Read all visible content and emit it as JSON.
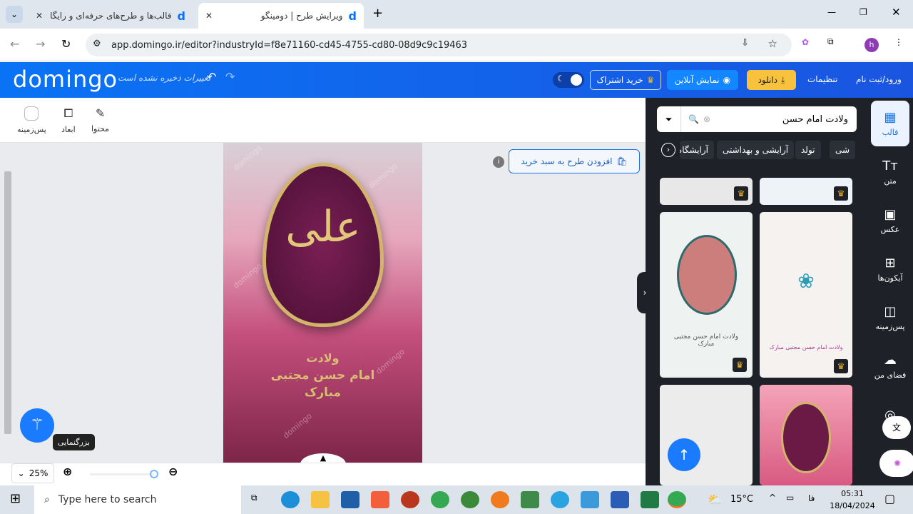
{
  "browser": {
    "tabs": [
      {
        "title": "قالب‌ها و طرح‌های حرفه‌ای و رایگا"
      },
      {
        "title": "ویرایش طرح | دومینگو"
      }
    ],
    "url": "app.domingo.ir/editor?industryId=f8e71160-cd45-4755-cd80-08d9c9c19463",
    "profile_initial": "h"
  },
  "header": {
    "logo": "domingo",
    "save_status": "تغییرات ذخیره نشده است",
    "subscribe": "خرید اشتراک",
    "preview": "نمایش آنلاین",
    "download": "دانلود",
    "settings": "تنظیمات",
    "login": "ورود/ثبت نام"
  },
  "toolbar": {
    "background": "پس‌زمینه",
    "dimensions": "ابعاد",
    "content": "محتوا"
  },
  "canvas": {
    "add_to_cart": "افزودن طرح به سبد خرید",
    "watermark": "domingo",
    "poster_lines": [
      "ولادت",
      "امام حسن مجتبی",
      "مبارک"
    ]
  },
  "zoom": {
    "value": "25%",
    "tooltip": "بزرگنمایی"
  },
  "panel": {
    "search_value": "ولادت امام حسن",
    "chips": [
      "شی",
      "تولد",
      "آرایشی و بهداشتی",
      "آرایشگاه"
    ],
    "card_texts": [
      "ولادت امام حسن مجتبی مبارک",
      "ولادت امام حسن مجتبی مبارک"
    ]
  },
  "sidebar": {
    "items": [
      "قالب",
      "متن",
      "عکس",
      "آیکون‌ها",
      "پس‌زمینه",
      "فضای من"
    ]
  },
  "taskbar": {
    "search_placeholder": "Type here to search",
    "temperature": "15°C",
    "lang": "فا",
    "time": "05:31",
    "date": "18/04/2024"
  },
  "colors": {
    "brand": "#0a73f5",
    "download": "#f9c23c",
    "panel": "#1e2228"
  }
}
